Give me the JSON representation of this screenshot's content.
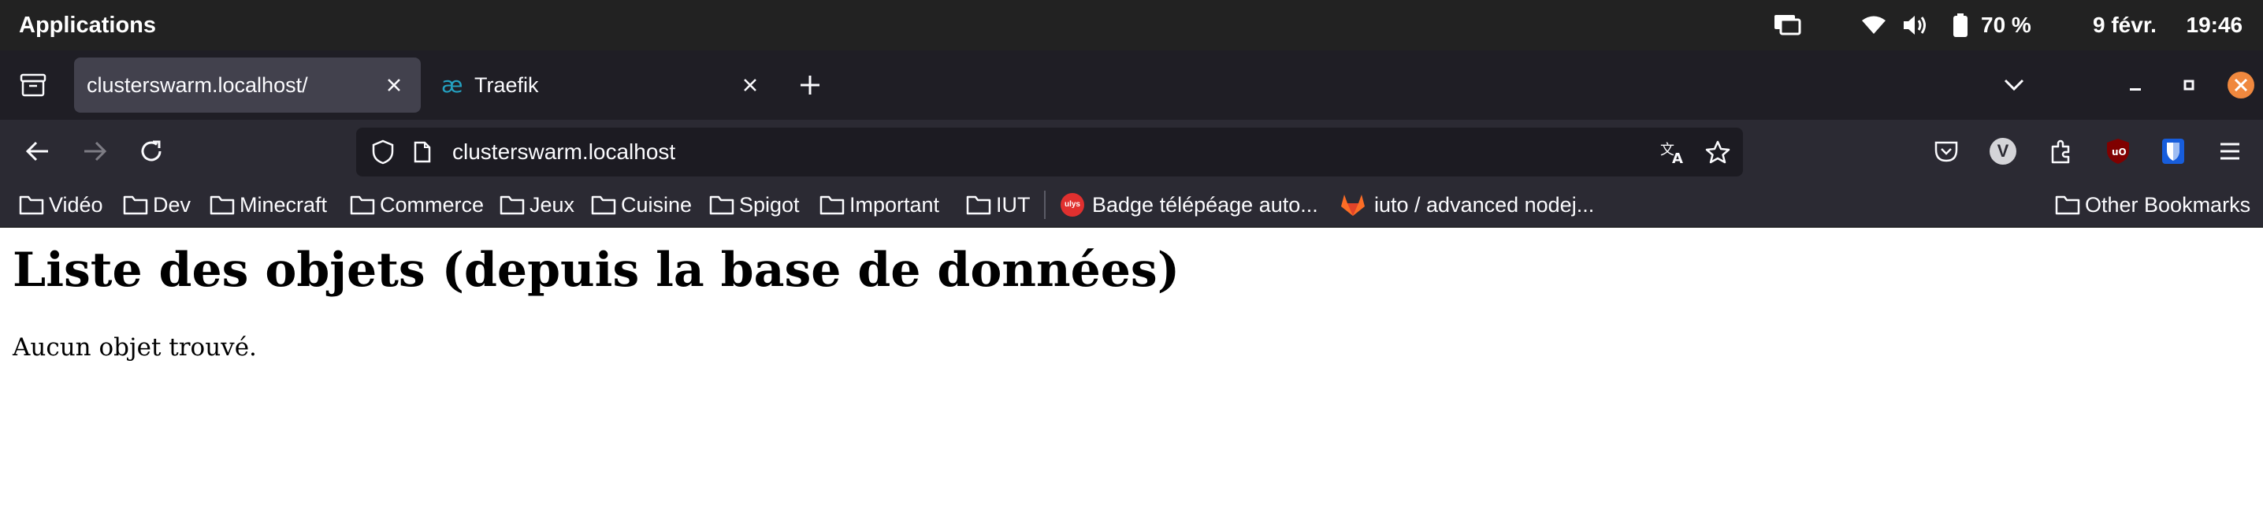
{
  "system_bar": {
    "apps_label": "Applications",
    "battery_percent": "70 %",
    "date": "9 févr.",
    "time": "19:46"
  },
  "tabs": [
    {
      "title": "clusterswarm.localhost/",
      "active": true
    },
    {
      "title": "Traefik",
      "active": false
    }
  ],
  "navigation": {
    "url": "clusterswarm.localhost",
    "extension_badge": "V"
  },
  "bookmarks": {
    "items": [
      {
        "label": "Vidéo",
        "icon": "folder-icon"
      },
      {
        "label": "Dev",
        "icon": "folder-icon"
      },
      {
        "label": "Minecraft",
        "icon": "folder-icon"
      },
      {
        "label": "Commerce",
        "icon": "folder-icon"
      },
      {
        "label": "Jeux",
        "icon": "folder-icon"
      },
      {
        "label": "Cuisine",
        "icon": "folder-icon"
      },
      {
        "label": "Spigot",
        "icon": "folder-icon"
      },
      {
        "label": "Important",
        "icon": "folder-icon"
      },
      {
        "label": "IUT",
        "icon": "folder-icon"
      },
      {
        "label": "Badge télépéage auto...",
        "icon": "ulys-icon",
        "icon_text": "ulys"
      },
      {
        "label": "iuto / advanced nodej...",
        "icon": "gitlab-icon"
      }
    ],
    "other_label": "Other Bookmarks"
  },
  "page": {
    "heading": "Liste des objets (depuis la base de données)",
    "message": "Aucun objet trouvé."
  },
  "colors": {
    "accent_close": "#f0883e",
    "ulys": "#e0302f",
    "gitlab": "#fc6d26",
    "traefik": "#24a1c1",
    "bitwarden": "#175ddc",
    "ublock": "#800000"
  }
}
